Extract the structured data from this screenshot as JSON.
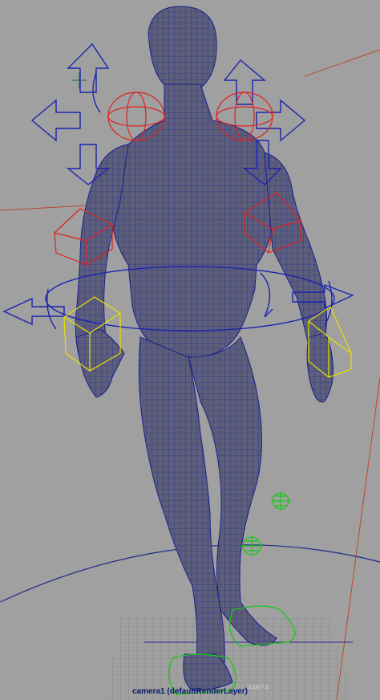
{
  "viewport": {
    "camera_label": "camera1 (defaultRenderLayer)",
    "frame_readout": "34674"
  },
  "colors": {
    "background": "#a0a0a0",
    "mesh_fill": "#5a5c78",
    "wireframe": "#1c1f9a",
    "ik_handle": "#e02020",
    "selection_box": "#e8e000",
    "move_arrow": "#1a24b0",
    "locator": "#18c818",
    "grid": "#7c7c7c",
    "scene_line": "#b04020"
  },
  "icons": [
    "move-arrows-icon",
    "rotate-ring-icon",
    "ik-sphere-icon",
    "locator-icon",
    "ground-grid-icon"
  ]
}
